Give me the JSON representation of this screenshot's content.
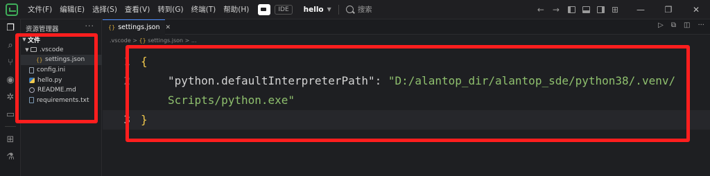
{
  "menu": [
    "文件(F)",
    "编辑(E)",
    "选择(S)",
    "查看(V)",
    "转到(G)",
    "终端(T)",
    "帮助(H)"
  ],
  "ide_label": "IDE",
  "project_name": "hello",
  "search_placeholder": "搜索",
  "sidebar": {
    "title": "资源管理器",
    "more": "···",
    "root": "文件",
    "tree": [
      {
        "label": ".vscode",
        "type": "folder",
        "depth": 1,
        "expanded": true
      },
      {
        "label": "settings.json",
        "type": "json",
        "depth": 2,
        "selected": true
      },
      {
        "label": "config.ini",
        "type": "doc",
        "depth": 1
      },
      {
        "label": "hello.py",
        "type": "python",
        "depth": 1
      },
      {
        "label": "README.md",
        "type": "info",
        "depth": 1
      },
      {
        "label": "requirements.txt",
        "type": "txt",
        "depth": 1
      }
    ]
  },
  "editor": {
    "tab_label": "settings.json",
    "tab_icon": "{}",
    "breadcrumb": [
      ".vscode",
      "settings.json",
      "..."
    ],
    "lines": {
      "l1_num": "1",
      "l1_text": "{",
      "l2_num": "2",
      "l2_key": "\"python.defaultInterpreterPath\"",
      "l2_colon": ": ",
      "l2_value_part1": "\"D:/alantop_dir/alantop_sde/python38/.venv/",
      "l2_value_part2": "Scripts/python.exe\"",
      "l3_num": "3",
      "l3_text": "}"
    }
  },
  "colors": {
    "highlight": "#ff1e1e",
    "string": "#8fc06e",
    "brace": "#f2c94c",
    "json_icon": "#d7a83a",
    "tab_accent": "#4a8cff"
  }
}
